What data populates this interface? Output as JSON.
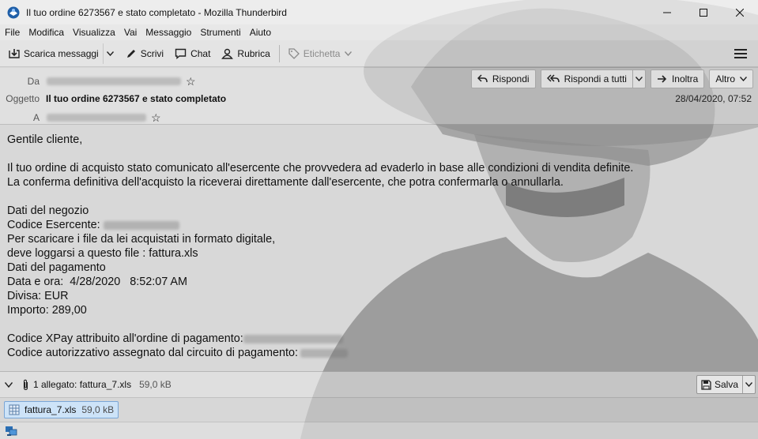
{
  "window": {
    "title": "Il tuo ordine 6273567 e stato completato - Mozilla Thunderbird",
    "app_icon": "thunderbird-icon",
    "controls": [
      "minimize-icon",
      "maximize-icon",
      "close-icon"
    ]
  },
  "menubar": {
    "items": [
      "File",
      "Modifica",
      "Visualizza",
      "Vai",
      "Messaggio",
      "Strumenti",
      "Aiuto"
    ]
  },
  "toolbar": {
    "get_messages": "Scarica messaggi",
    "write": "Scrivi",
    "chat": "Chat",
    "address_book": "Rubrica",
    "tag": "Etichetta"
  },
  "header": {
    "from_label": "Da",
    "subject_label": "Oggetto",
    "to_label": "A",
    "subject": "Il tuo ordine 6273567 e stato completato",
    "date": "28/04/2020, 07:52",
    "actions": {
      "reply": "Rispondi",
      "reply_all": "Rispondi a tutti",
      "forward": "Inoltra",
      "more": "Altro"
    }
  },
  "message": {
    "greeting": "Gentile cliente,",
    "line1": "Il tuo ordine di acquisto stato comunicato all'esercente che provvedera ad evaderlo in base alle condizioni di vendita definite.",
    "line2": "La conferma definitiva dell'acquisto la riceverai direttamente dall'esercente, che potra confermarla o annullarla.",
    "store_data": "Dati del negozio",
    "merchant_code": "Codice Esercente:",
    "download_line1": "Per scaricare i file da lei acquistati in formato digitale,",
    "download_line2": "deve loggarsi a questo file : fattura.xls",
    "payment_data": "Dati del pagamento",
    "datetime": "Data e ora:  4/28/2020   8:52:07 AM",
    "currency": "Divisa: EUR",
    "amount": "Importo: 289,00",
    "xpay_code": "Codice XPay attribuito all'ordine di pagamento:",
    "auth_code": "Codice autorizzativo assegnato dal circuito di pagamento:"
  },
  "attachments": {
    "summary": "1 allegato: fattura_7.xls",
    "summary_size": "59,0 kB",
    "save": "Salva",
    "file_name": "fattura_7.xls",
    "file_size": "59,0 kB"
  }
}
